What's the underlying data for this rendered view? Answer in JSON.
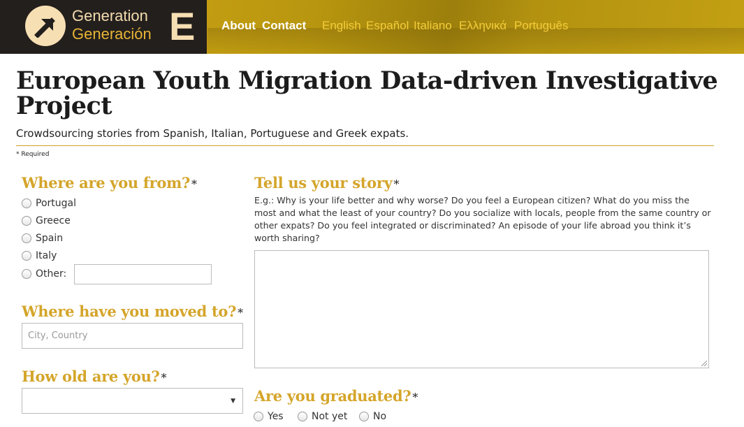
{
  "header": {
    "logo_line1": "Generation",
    "logo_line2": "Generación",
    "logo_letter": "E",
    "nav": [
      {
        "label": "About"
      },
      {
        "label": "Contact"
      }
    ],
    "languages": [
      {
        "label": "English"
      },
      {
        "label": "Español"
      },
      {
        "label": "Italiano"
      },
      {
        "label": "Ελληνικά"
      },
      {
        "label": "Português"
      }
    ],
    "colors": {
      "bar": "#231f1c",
      "accent": "#d4a52a",
      "nav_lang": "#f3cc3a"
    }
  },
  "page": {
    "title": "European Youth Migration Data-driven Investigative Project",
    "subtitle": "Crowdsourcing stories from Spanish, Italian, Portuguese and Greek expats.",
    "required_note": "* Required"
  },
  "form": {
    "origin": {
      "question": "Where are you from?",
      "star": "*",
      "options": [
        {
          "label": "Portugal"
        },
        {
          "label": "Greece"
        },
        {
          "label": "Spain"
        },
        {
          "label": "Italy"
        },
        {
          "label": "Other:"
        }
      ]
    },
    "destination": {
      "question": "Where have you moved to?",
      "star": "*",
      "placeholder": "City, Country"
    },
    "age": {
      "question": "How old are you?",
      "star": "*",
      "selected": ""
    },
    "story": {
      "question": "Tell us your story",
      "star": "*",
      "description": "E.g.: Why is your life better and why worse? Do you feel a European citizen? What do you miss the most and what the least of your country? Do you socialize with locals, people from the same country or other expats? Do you feel integrated or discriminated? An episode of your life abroad you think it’s worth sharing?"
    },
    "graduated": {
      "question": "Are you graduated?",
      "star": "*",
      "options": [
        {
          "label": "Yes"
        },
        {
          "label": "Not yet"
        },
        {
          "label": "No"
        }
      ]
    }
  }
}
